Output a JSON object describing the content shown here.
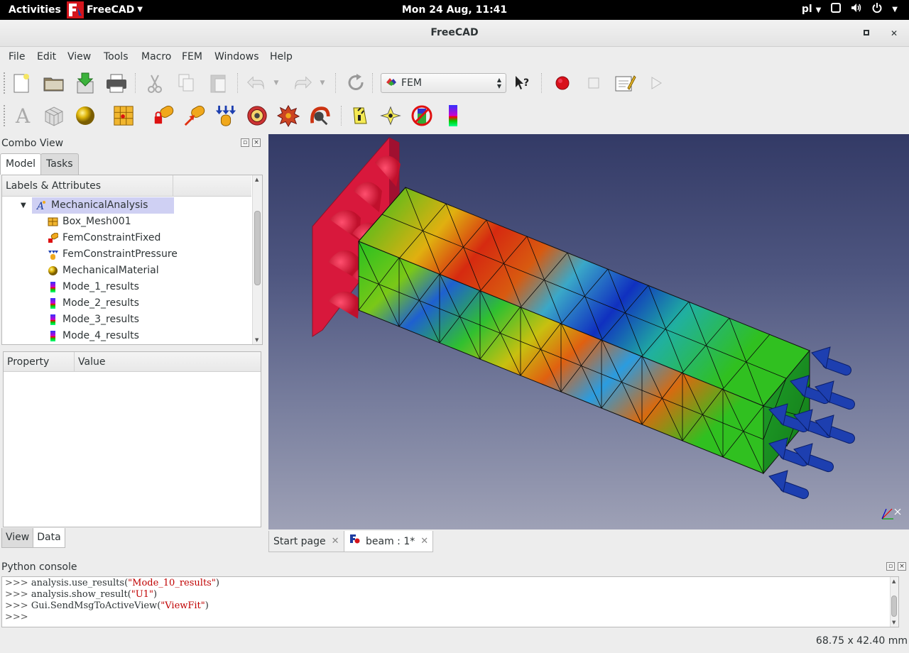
{
  "topbar": {
    "activities": "Activities",
    "app_name": "FreeCAD",
    "clock": "Mon 24 Aug, 11:41",
    "keyboard": "pl"
  },
  "window": {
    "title": "FreeCAD"
  },
  "menubar": [
    "File",
    "Edit",
    "View",
    "Tools",
    "Macro",
    "FEM",
    "Windows",
    "Help"
  ],
  "toolbar": {
    "workbench": "FEM"
  },
  "combo_view": {
    "title": "Combo View",
    "tabs": [
      "Model",
      "Tasks"
    ],
    "tree_header": "Labels & Attributes",
    "tree": [
      "MechanicalAnalysis",
      "Box_Mesh001",
      "FemConstraintFixed",
      "FemConstraintPressure",
      "MechanicalMaterial",
      "Mode_1_results",
      "Mode_2_results",
      "Mode_3_results",
      "Mode_4_results"
    ],
    "property_columns": [
      "Property",
      "Value"
    ],
    "bottom_tabs": [
      "View",
      "Data"
    ]
  },
  "document_tabs": [
    "Start page",
    "beam : 1*"
  ],
  "python_console": {
    "title": "Python console",
    "prompt": ">>>",
    "lines": [
      {
        "code": "analysis.use_results(",
        "str": "\"Mode_10_results\"",
        "end": ")"
      },
      {
        "code": "analysis.show_result(",
        "str": "\"U1\"",
        "end": ")"
      },
      {
        "code": "Gui.SendMsgToActiveView(",
        "str": "\"ViewFit\"",
        "end": ")"
      },
      {
        "code": "",
        "str": "",
        "end": ""
      }
    ]
  },
  "statusbar": {
    "dimensions": "68.75 x 42.40 mm"
  },
  "colors": {
    "selection": "#cfd0f3",
    "fixed_constraint": "#d8183c",
    "pressure_arrow": "#1d3fb0"
  }
}
